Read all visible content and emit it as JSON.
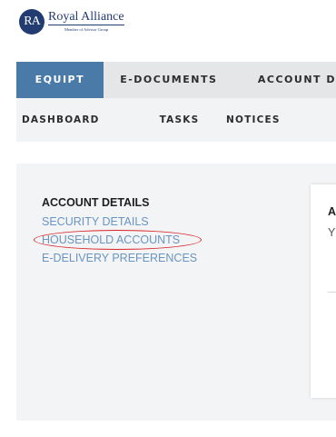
{
  "brand": {
    "logo_initials": "RA",
    "name": "Royal Alliance",
    "tagline": "Member of Advisor Group",
    "color": "#223b70"
  },
  "primary_nav": {
    "tabs": [
      {
        "label": "EQUIPT",
        "active": true
      },
      {
        "label": "E-DOCUMENTS",
        "active": false
      },
      {
        "label": "ACCOUNT D",
        "active": false
      }
    ],
    "active_color": "#4a7ba8"
  },
  "secondary_nav": {
    "tabs": [
      {
        "label": "DASHBOARD"
      },
      {
        "label": "TASKS"
      },
      {
        "label": "NOTICES"
      }
    ]
  },
  "side_menu": {
    "heading": "ACCOUNT DETAILS",
    "links": [
      {
        "label": "SECURITY DETAILS"
      },
      {
        "label": "HOUSEHOLD ACCOUNTS",
        "highlighted": true
      },
      {
        "label": "E-DELIVERY PREFERENCES"
      }
    ],
    "link_color": "#6a95c1",
    "highlight_color": "#d9252a"
  },
  "card": {
    "title": "A",
    "text": "Y"
  }
}
